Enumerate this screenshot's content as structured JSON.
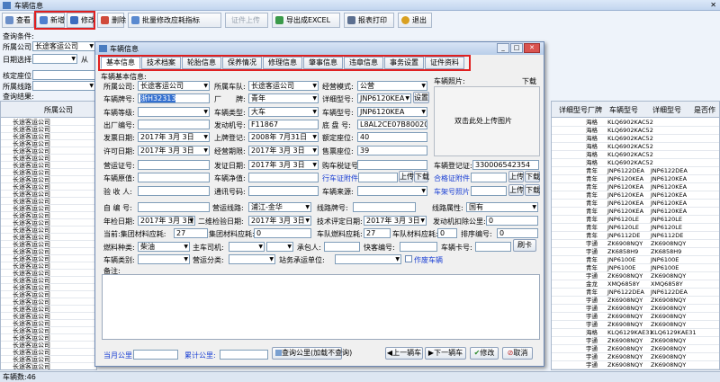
{
  "window": {
    "title": "车辆信息"
  },
  "toolbar": {
    "view": "查看",
    "add": "新增",
    "edit": "修改",
    "delete": "删除",
    "batch": "批量修改应耗指标",
    "cert_upload": "证件上传",
    "export": "导出成EXCEL",
    "print": "报表打印",
    "exit": "退出"
  },
  "filters": {
    "section": "查询条件:",
    "company_label": "所属公司:",
    "company_value": "长途客运公司",
    "date_label": "日期选择:",
    "date_suffix": "从",
    "seats_label": "核定座位:",
    "team_label": "所属线路:"
  },
  "results": {
    "label": "查询结果:",
    "col_company": "所属公司",
    "row_value": "长途客运公司"
  },
  "right_grid": {
    "headers": [
      "详细型号",
      "厂牌",
      "车辆型号",
      "详细型号",
      "是否作"
    ],
    "rows": [
      [
        "海格",
        "KLQ6902KAC52",
        ""
      ],
      [
        "海格",
        "KLQ6902KAC52",
        ""
      ],
      [
        "海格",
        "KLQ6902KAC52",
        ""
      ],
      [
        "海格",
        "KLQ6902KAC52",
        ""
      ],
      [
        "海格",
        "KLQ6902KAC52",
        ""
      ],
      [
        "海格",
        "KLQ6902KAC52",
        ""
      ],
      [
        "青年",
        "JNP6122DEA",
        "JNP6122DEA"
      ],
      [
        "青年",
        "JNP6120KEA",
        "JNP6120KEA"
      ],
      [
        "青年",
        "JNP6120KEA",
        "JNP6120KEA"
      ],
      [
        "青年",
        "JNP6120KEA",
        "JNP6120KEA"
      ],
      [
        "青年",
        "JNP6120KEA",
        "JNP6120KEA"
      ],
      [
        "青年",
        "JNP6120KEA",
        "JNP6120KEA"
      ],
      [
        "青年",
        "JNP6120LE",
        "JNP6120LE"
      ],
      [
        "青年",
        "JNP6120LE",
        "JNP6120LE"
      ],
      [
        "青年",
        "JNP6112DE",
        "JNP6112DE"
      ],
      [
        "宇通",
        "ZK6908NQY",
        "ZK6908NQY"
      ],
      [
        "宇通",
        "ZK6858H9",
        "ZK6858H9"
      ],
      [
        "青年",
        "JNP6100E",
        "JNP6100E"
      ],
      [
        "青年",
        "JNP6100E",
        "JNP6100E"
      ],
      [
        "宇通",
        "ZK6908NQY",
        "ZK6908NQY"
      ],
      [
        "金龙",
        "XMQ6858Y",
        "XMQ6858Y"
      ],
      [
        "青年",
        "JNP6122DEA",
        "JNP6122DEA"
      ],
      [
        "宇通",
        "ZK6908NQY",
        "ZK6908NQY"
      ],
      [
        "宇通",
        "ZK6908NQY",
        "ZK6908NQY"
      ],
      [
        "宇通",
        "ZK6908NQY",
        "ZK6908NQY"
      ],
      [
        "宇通",
        "ZK6908NQY",
        "ZK6908NQY"
      ],
      [
        "海格",
        "KLQ6129KAE31",
        "KLQ6129KAE31"
      ],
      [
        "宇通",
        "ZK6908NQY",
        "ZK6908NQY"
      ],
      [
        "宇通",
        "ZK6908NQY",
        "ZK6908NQY"
      ],
      [
        "宇通",
        "ZK6908NQY",
        "ZK6908NQY"
      ],
      [
        "宇通",
        "ZK6908NQY",
        "ZK6908NQY"
      ]
    ]
  },
  "status": {
    "text": "车辆数:46"
  },
  "dialog": {
    "title": "车辆信息",
    "tabs": [
      "基本信息",
      "技术档案",
      "轮胎信息",
      "保养情况",
      "修理信息",
      "肇事信息",
      "违章信息",
      "事务设置",
      "证件资料"
    ],
    "group": "车辆基本信息:",
    "company_label": "所属公司:",
    "company_value": "长途客运公司",
    "team_label": "所属车队:",
    "team_value": "长途客运公司",
    "mode_label": "经营模式:",
    "mode_value": "公营",
    "plate_label": "车辆牌号:",
    "plate_value": "浙H32313",
    "brand_label": "厂　　牌:",
    "brand_value": "青年",
    "detail_model_label": "详细型号:",
    "detail_model_value": "JNP6120KEA",
    "settings_btn": "设置",
    "grade_label": "车辆等级:",
    "type_label": "车辆类型:",
    "type_value": "大车",
    "model_label": "车辆型号:",
    "model_value": "JNP6120KEA",
    "factory_label": "出厂编号:",
    "engine_label": "发动机号:",
    "engine_value": "F11867",
    "chassis_label": "底 盘 号:",
    "chassis_value": "L8AL2CE07B8002006",
    "issue_label": "发票日期:",
    "issue_value": "2017年 3月 3日",
    "reg_label": "上牌登记:",
    "reg_value": "2008年 7月31日",
    "seats_label": "额定座位:",
    "seats_value": "40",
    "permit_label": "许可日期:",
    "permit_value": "2017年 3月 3日",
    "service_label": "经营期限:",
    "service_value": "2017年 3月 3日",
    "sale_label": "售票座位:",
    "sale_value": "39",
    "cert_label": "营运证号:",
    "cert_date_label": "发证日期:",
    "cert_date_value": "2017年 3月 3日",
    "tax_label": "购车税证号:",
    "origin_label": "车辆原值:",
    "net_label": "车辆净值:",
    "license_label": "行车证附件",
    "upload": "上传",
    "download": "下载",
    "insp_label": "验 收 人:",
    "comm_label": "通讯号码:",
    "source_label": "车辆来源:",
    "photo_label": "车辆照片:",
    "photo_download": "下载",
    "photo_hint": "双击此处上传图片",
    "regcert_label": "车辆登记证:",
    "regcert_value": "330006542354",
    "qual_label": "合格证附件",
    "frame_label": "车架号照片",
    "auto_label": "自 编 号:",
    "route_label": "营运线路:",
    "route_value": "浦江-金华",
    "plate2_label": "线路牌号:",
    "attr_label": "线路属性:",
    "attr_value": "国有",
    "annual_label": "年检日期:",
    "annual_value": "2017年 3月 3日",
    "maint_label": "二维检验日期:",
    "maint_value": "2017年 3月 3日",
    "tech_label": "技术评定日期:",
    "tech_value": "2017年 3月 3日",
    "km_label": "发动机扣除公里:",
    "km_value": "0",
    "group_mat_label": "当前:集团材料应耗:",
    "group_mat_value": "27",
    "group_fuel_label": "集团材料应耗:",
    "group_fuel_value": "0",
    "team_fuel_label": "车队燃料应耗:",
    "team_fuel_value": "27",
    "team_mat_label": "车队材料应耗:",
    "team_mat_value": "0",
    "order_label": "排序编号:",
    "order_value": "0",
    "fuel_label": "燃料种类:",
    "fuel_value": "柴油",
    "driver_label": "主车司机:",
    "pkg_label": "承包人:",
    "express_label": "快客编号:",
    "card_label": "车辆卡号:",
    "card_btn": "刷卡",
    "cat_label": "车辆类别:",
    "opcat_label": "营运分类:",
    "station_label": "站务承运单位:",
    "void_label": "作废车辆",
    "remark_label": "备注:",
    "cur_km_label": "当月公里:",
    "total_km_label": "累计公里:",
    "query_km": "查询公里(加载不查询)",
    "prev": "上一辆车",
    "next": "下一辆车",
    "save": "修改",
    "cancel": "取消"
  }
}
